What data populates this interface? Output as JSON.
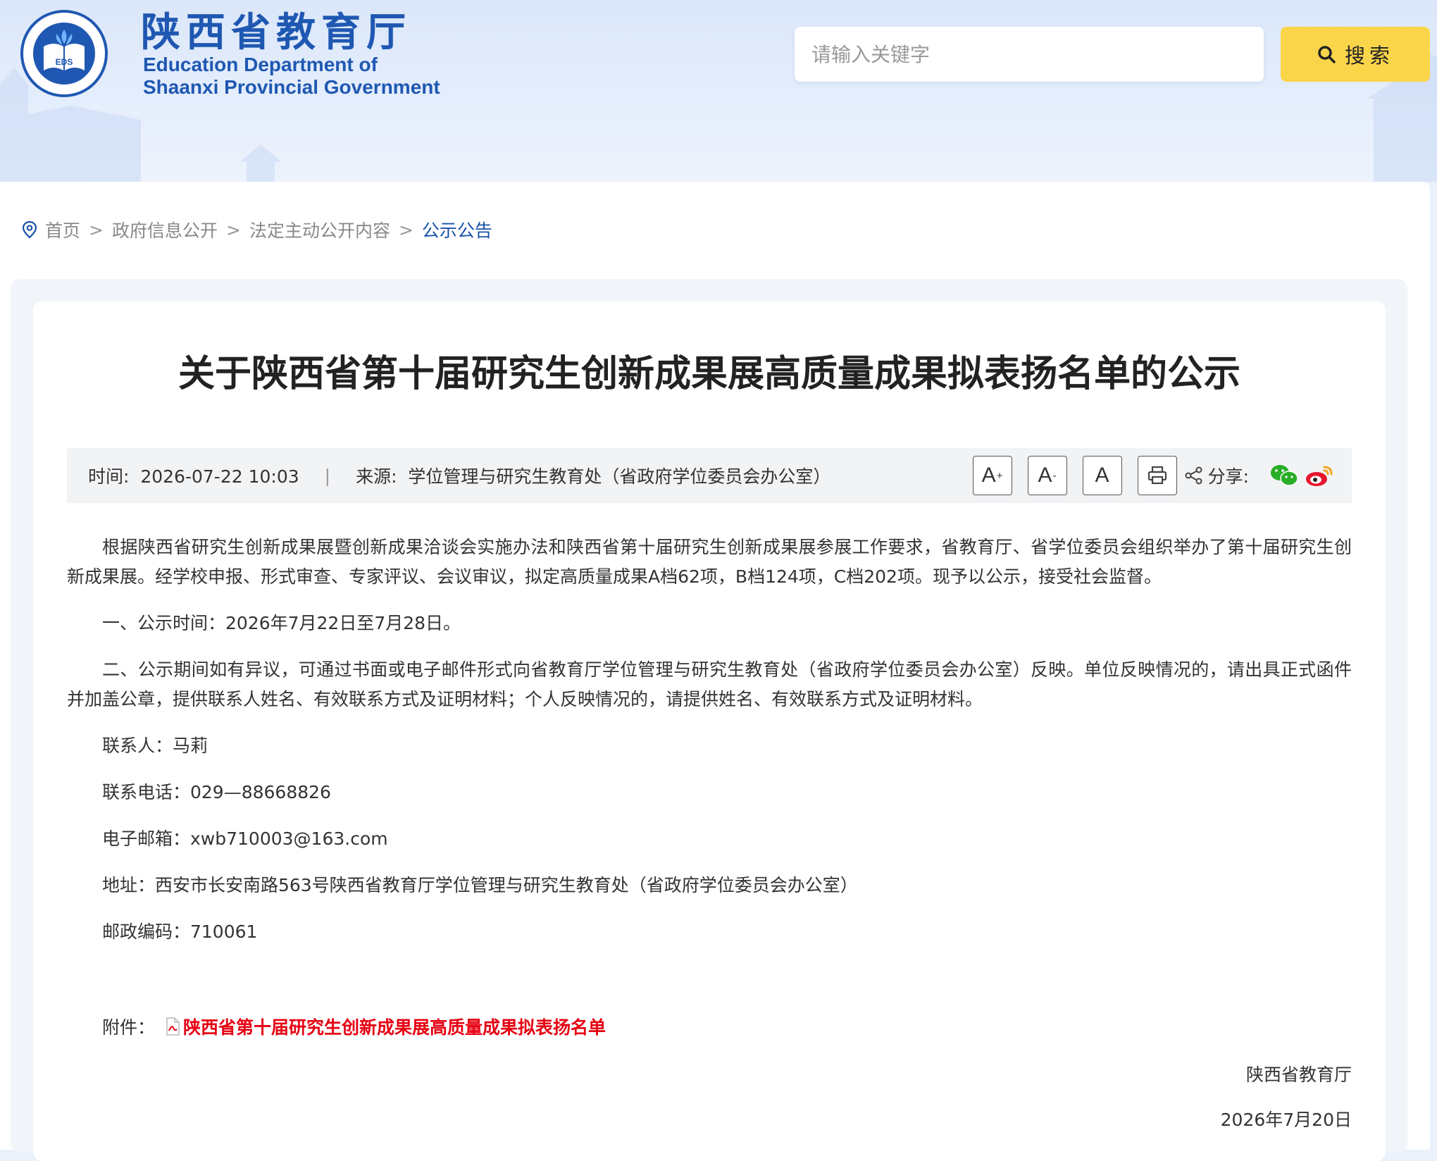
{
  "header": {
    "logo_cn": "陕西省教育厅",
    "logo_en_line1": "Education Department of",
    "logo_en_line2": "Shaanxi Provincial Government",
    "emblem_text": "EDUCATION DEPARTMENT OF SHAANXI",
    "emblem_center": "EDS",
    "emblem_bottom": "陕西省教育厅"
  },
  "search": {
    "placeholder": "请输入关键字",
    "button_label": "搜索",
    "icon": "search-icon"
  },
  "breadcrumb": {
    "icon": "location-pin-icon",
    "items": [
      "首页",
      "政府信息公开",
      "法定主动公开内容",
      "公示公告"
    ],
    "separator": ">"
  },
  "article": {
    "title": "关于陕西省第十届研究生创新成果展高质量成果拟表扬名单的公示",
    "meta": {
      "time_label": "时间:",
      "time_value": "2026-07-22 10:03",
      "divider": "|",
      "source_label": "来源:",
      "source_value": "学位管理与研究生教育处（省政府学位委员会办公室）"
    },
    "tools": {
      "font_large": "A",
      "font_small": "A",
      "font_default": "A",
      "print_icon": "printer-icon",
      "share_label": "分享:",
      "share_icon": "share-icon",
      "wechat_icon": "wechat-icon",
      "weibo_icon": "weibo-icon"
    },
    "paragraphs": [
      "根据陕西省研究生创新成果展暨创新成果洽谈会实施办法和陕西省第十届研究生创新成果展参展工作要求，省教育厅、省学位委员会组织举办了第十届研究生创新成果展。经学校申报、形式审查、专家评议、会议审议，拟定高质量成果A档62项，B档124项，C档202项。现予以公示，接受社会监督。",
      "一、公示时间：2026年7月22日至7月28日。",
      "二、公示期间如有异议，可通过书面或电子邮件形式向省教育厅学位管理与研究生教育处（省政府学位委员会办公室）反映。单位反映情况的，请出具正式函件并加盖公章，提供联系人姓名、有效联系方式及证明材料；个人反映情况的，请提供姓名、有效联系方式及证明材料。",
      "联系人：马莉",
      "联系电话：029—88668826",
      "电子邮箱：xwb710003@163.com",
      "地址：西安市长安南路563号陕西省教育厅学位管理与研究生教育处（省政府学位委员会办公室）",
      "邮政编码：710061"
    ],
    "attachment_label": "附件：",
    "attachment_icon": "pdf-file-icon",
    "attachment_link": "陕西省第十届研究生创新成果展高质量成果拟表扬名单",
    "signer": "陕西省教育厅",
    "sign_date": "2026年7月20日"
  },
  "colors": {
    "brand_blue": "#1f58b2",
    "search_button": "#fad54a",
    "link_red": "#e60012",
    "breadcrumb_active": "#1a52a8"
  }
}
